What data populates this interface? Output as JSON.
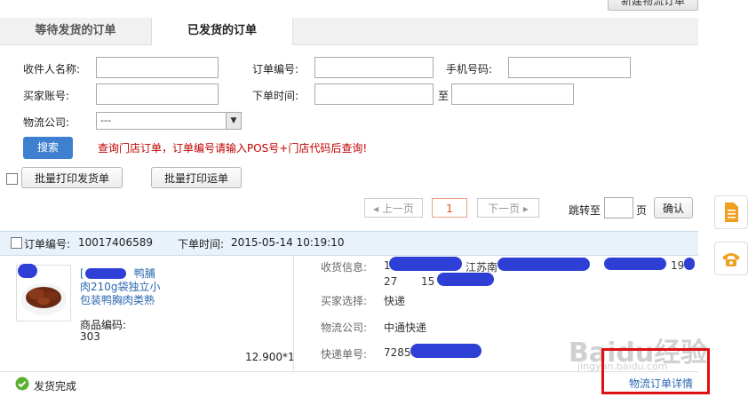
{
  "top_button": "新建物流订单",
  "tabs": [
    {
      "label": "等待发货的订单"
    },
    {
      "label": "已发货的订单"
    }
  ],
  "form": {
    "receiver_label": "收件人名称:",
    "order_no_label": "订单编号:",
    "phone_label": "手机号码:",
    "buyer_label": "买家账号:",
    "order_time_label": "下单时间:",
    "to_label": "至",
    "logistics_label": "物流公司:",
    "logistics_value": "---"
  },
  "search_button": "搜索",
  "hint": "查询门店订单，订单编号请输入POS号+门店代码后查询!",
  "batch_print_delivery": "批量打印发货单",
  "batch_print_waybill": "批量打印运单",
  "pagination": {
    "prev": "上一页",
    "current": "1",
    "next": "下一页",
    "jump_label": "跳转至",
    "page_unit": "页",
    "confirm": "确认"
  },
  "order": {
    "order_no_label": "订单编号:",
    "order_no": "10017406589",
    "order_time_label": "下单时间:",
    "order_time": "2015-05-14 10:19:10",
    "product_tag": "[",
    "product_title_1": "鸭脯",
    "product_title_2": "肉210g袋独立小",
    "product_title_3": "包装鸭胸肉类熟",
    "product_code_label": "商品编码:",
    "product_code": "303",
    "price_qty": "12.900*1",
    "receive_info_label": "收货信息:",
    "receive_info_prefix": "1",
    "receive_info_text": "江苏南",
    "receive_info_tail": "19",
    "receive_info_line2_a": "27",
    "receive_info_line2_b": "15",
    "buyer_choice_label": "买家选择:",
    "buyer_choice": "快递",
    "logistics_label": "物流公司:",
    "logistics": "中通快递",
    "tracking_label": "快递单号:",
    "tracking": "7285"
  },
  "footer": {
    "status": "发货完成",
    "detail_link": "物流订单详情"
  },
  "watermark": "Baidu经验",
  "watermark_sub": "jingyan.baidu.com",
  "colors": {
    "accent": "#3f7fd0",
    "hint": "#c00000",
    "highlight_box": "#e01010",
    "side_icon": "#f0a020"
  }
}
